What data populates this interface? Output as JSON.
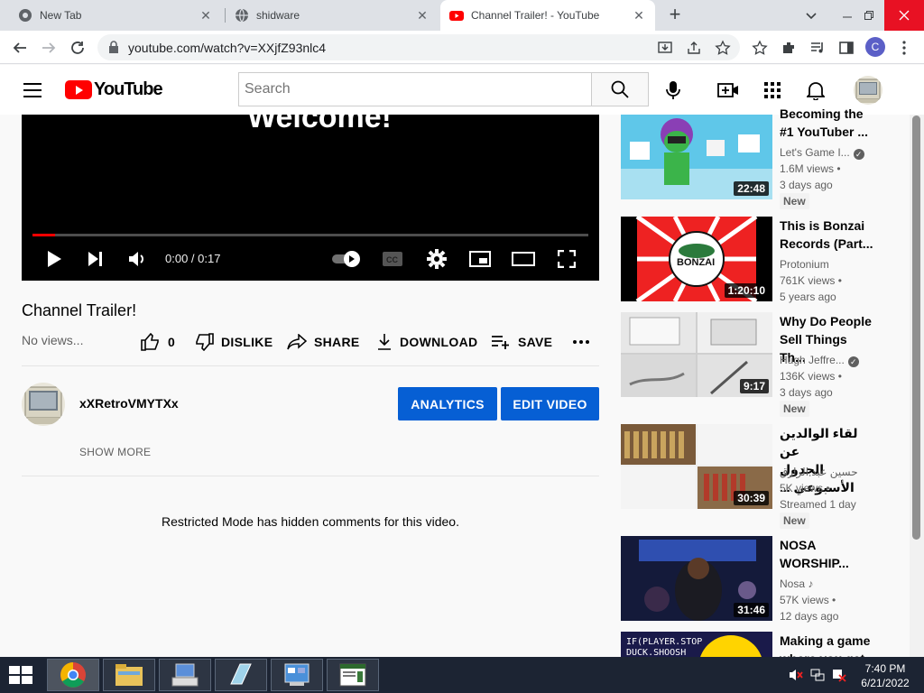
{
  "browser": {
    "tabs": [
      {
        "title": "New Tab",
        "icon": "chrome-icon",
        "active": false
      },
      {
        "title": "shidware",
        "icon": "globe-icon",
        "active": false
      },
      {
        "title": "Channel Trailer! - YouTube",
        "icon": "youtube-icon",
        "active": true
      }
    ],
    "url": "youtube.com/watch?v=XXjfZ93nlc4",
    "profile_letter": "C"
  },
  "youtube": {
    "logo_text": "YouTube",
    "search_placeholder": "Search",
    "brand_color": "#ff0000"
  },
  "player": {
    "overlay_text": "Welcome!",
    "time": "0:00 / 0:17",
    "progress_fraction": 0.04
  },
  "video": {
    "title": "Channel Trailer!",
    "views": "No views...",
    "like_count": "0",
    "actions": {
      "dislike": "DISLIKE",
      "share": "SHARE",
      "download": "DOWNLOAD",
      "save": "SAVE"
    }
  },
  "channel": {
    "name": "xXRetroVMYTXx",
    "analytics_label": "ANALYTICS",
    "edit_label": "EDIT VIDEO",
    "show_more": "SHOW MORE",
    "button_color": "#065fd4"
  },
  "comments": {
    "restricted_notice": "Restricted Mode has hidden comments for this video."
  },
  "recommendations": [
    {
      "title_l1": "Becoming the",
      "title_l2": "#1 YouTuber ...",
      "channel": "Let's Game I...",
      "verified": true,
      "views": "1.6M views •",
      "age": "3 days ago",
      "badge": "New",
      "duration": "22:48"
    },
    {
      "title_l1": "This is Bonzai",
      "title_l2": "Records (Part...",
      "channel": "Protonium",
      "verified": false,
      "views": "761K views •",
      "age": "5 years ago",
      "badge": "",
      "duration": "1:20:10"
    },
    {
      "title_l1": "Why Do People",
      "title_l2": "Sell Things Th...",
      "channel": "Hugh Jeffre...",
      "verified": true,
      "views": "136K views •",
      "age": "3 days ago",
      "badge": "New",
      "duration": "9:17"
    },
    {
      "title_l1": "لقاء الوالدين عن",
      "title_l2": "الجدول الأسبوعي ...",
      "channel": "حسين عبد الرازق",
      "verified": false,
      "views": "5K views •",
      "age": "Streamed 1 day",
      "badge": "New",
      "duration": "30:39"
    },
    {
      "title_l1": "NOSA",
      "title_l2": "WORSHIP...",
      "channel": "Nosa ♪",
      "verified": false,
      "views": "57K views •",
      "age": "12 days ago",
      "badge": "",
      "duration": "31:46"
    },
    {
      "title_l1": "Making a game",
      "title_l2": "where you get",
      "channel": "",
      "verified": false,
      "views": "",
      "age": "",
      "badge": "",
      "duration": ""
    }
  ],
  "taskbar": {
    "time": "7:40 PM",
    "date": "6/21/2022",
    "apps": [
      "chrome-icon",
      "file-explorer-icon",
      "keyboard-icon",
      "notepad-icon",
      "control-panel-icon",
      "window-app-icon"
    ]
  }
}
